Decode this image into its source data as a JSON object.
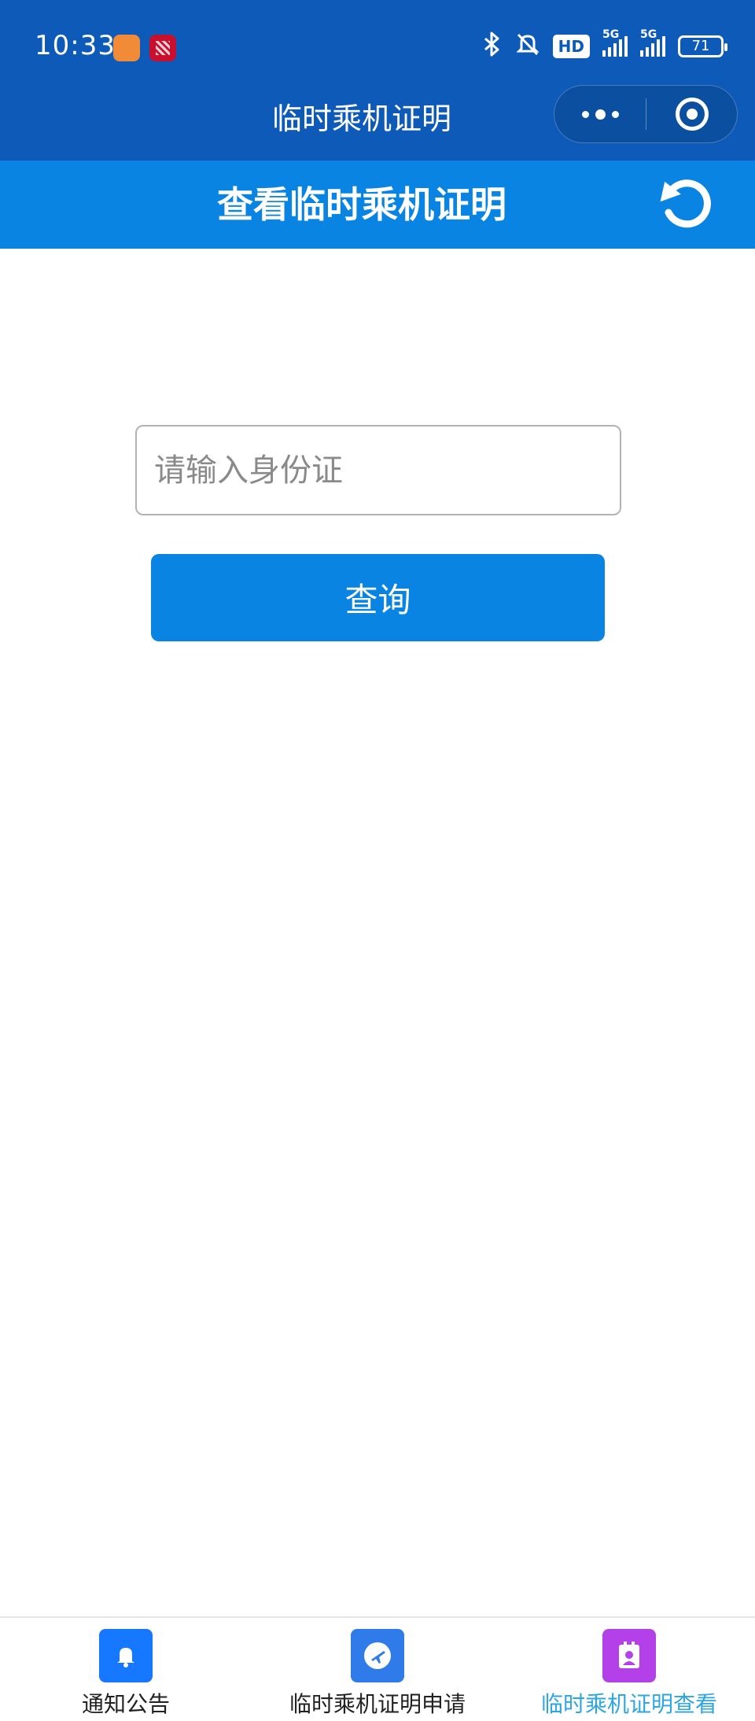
{
  "status_bar": {
    "time": "10:33",
    "signal_label_1": "5G",
    "signal_label_2": "5G",
    "hd_label": "HD",
    "battery": "71"
  },
  "nav": {
    "title": "临时乘机证明"
  },
  "header": {
    "title": "查看临时乘机证明"
  },
  "form": {
    "id_placeholder": "请输入身份证",
    "id_value": "",
    "query_label": "查询"
  },
  "tabbar": {
    "items": [
      {
        "label": "通知公告",
        "icon": "bell-icon",
        "color": "#1677ff"
      },
      {
        "label": "临时乘机证明申请",
        "icon": "airplane-icon",
        "color": "#2f7bea"
      },
      {
        "label": "临时乘机证明查看",
        "icon": "id-card-icon",
        "color": "#b340e8",
        "active": true
      }
    ]
  },
  "colors": {
    "status_bar_bg": "#0d5ab8",
    "header_bg": "#0a84e3",
    "button_bg": "#0a84e3",
    "active_tab_text": "#2ea6df"
  }
}
